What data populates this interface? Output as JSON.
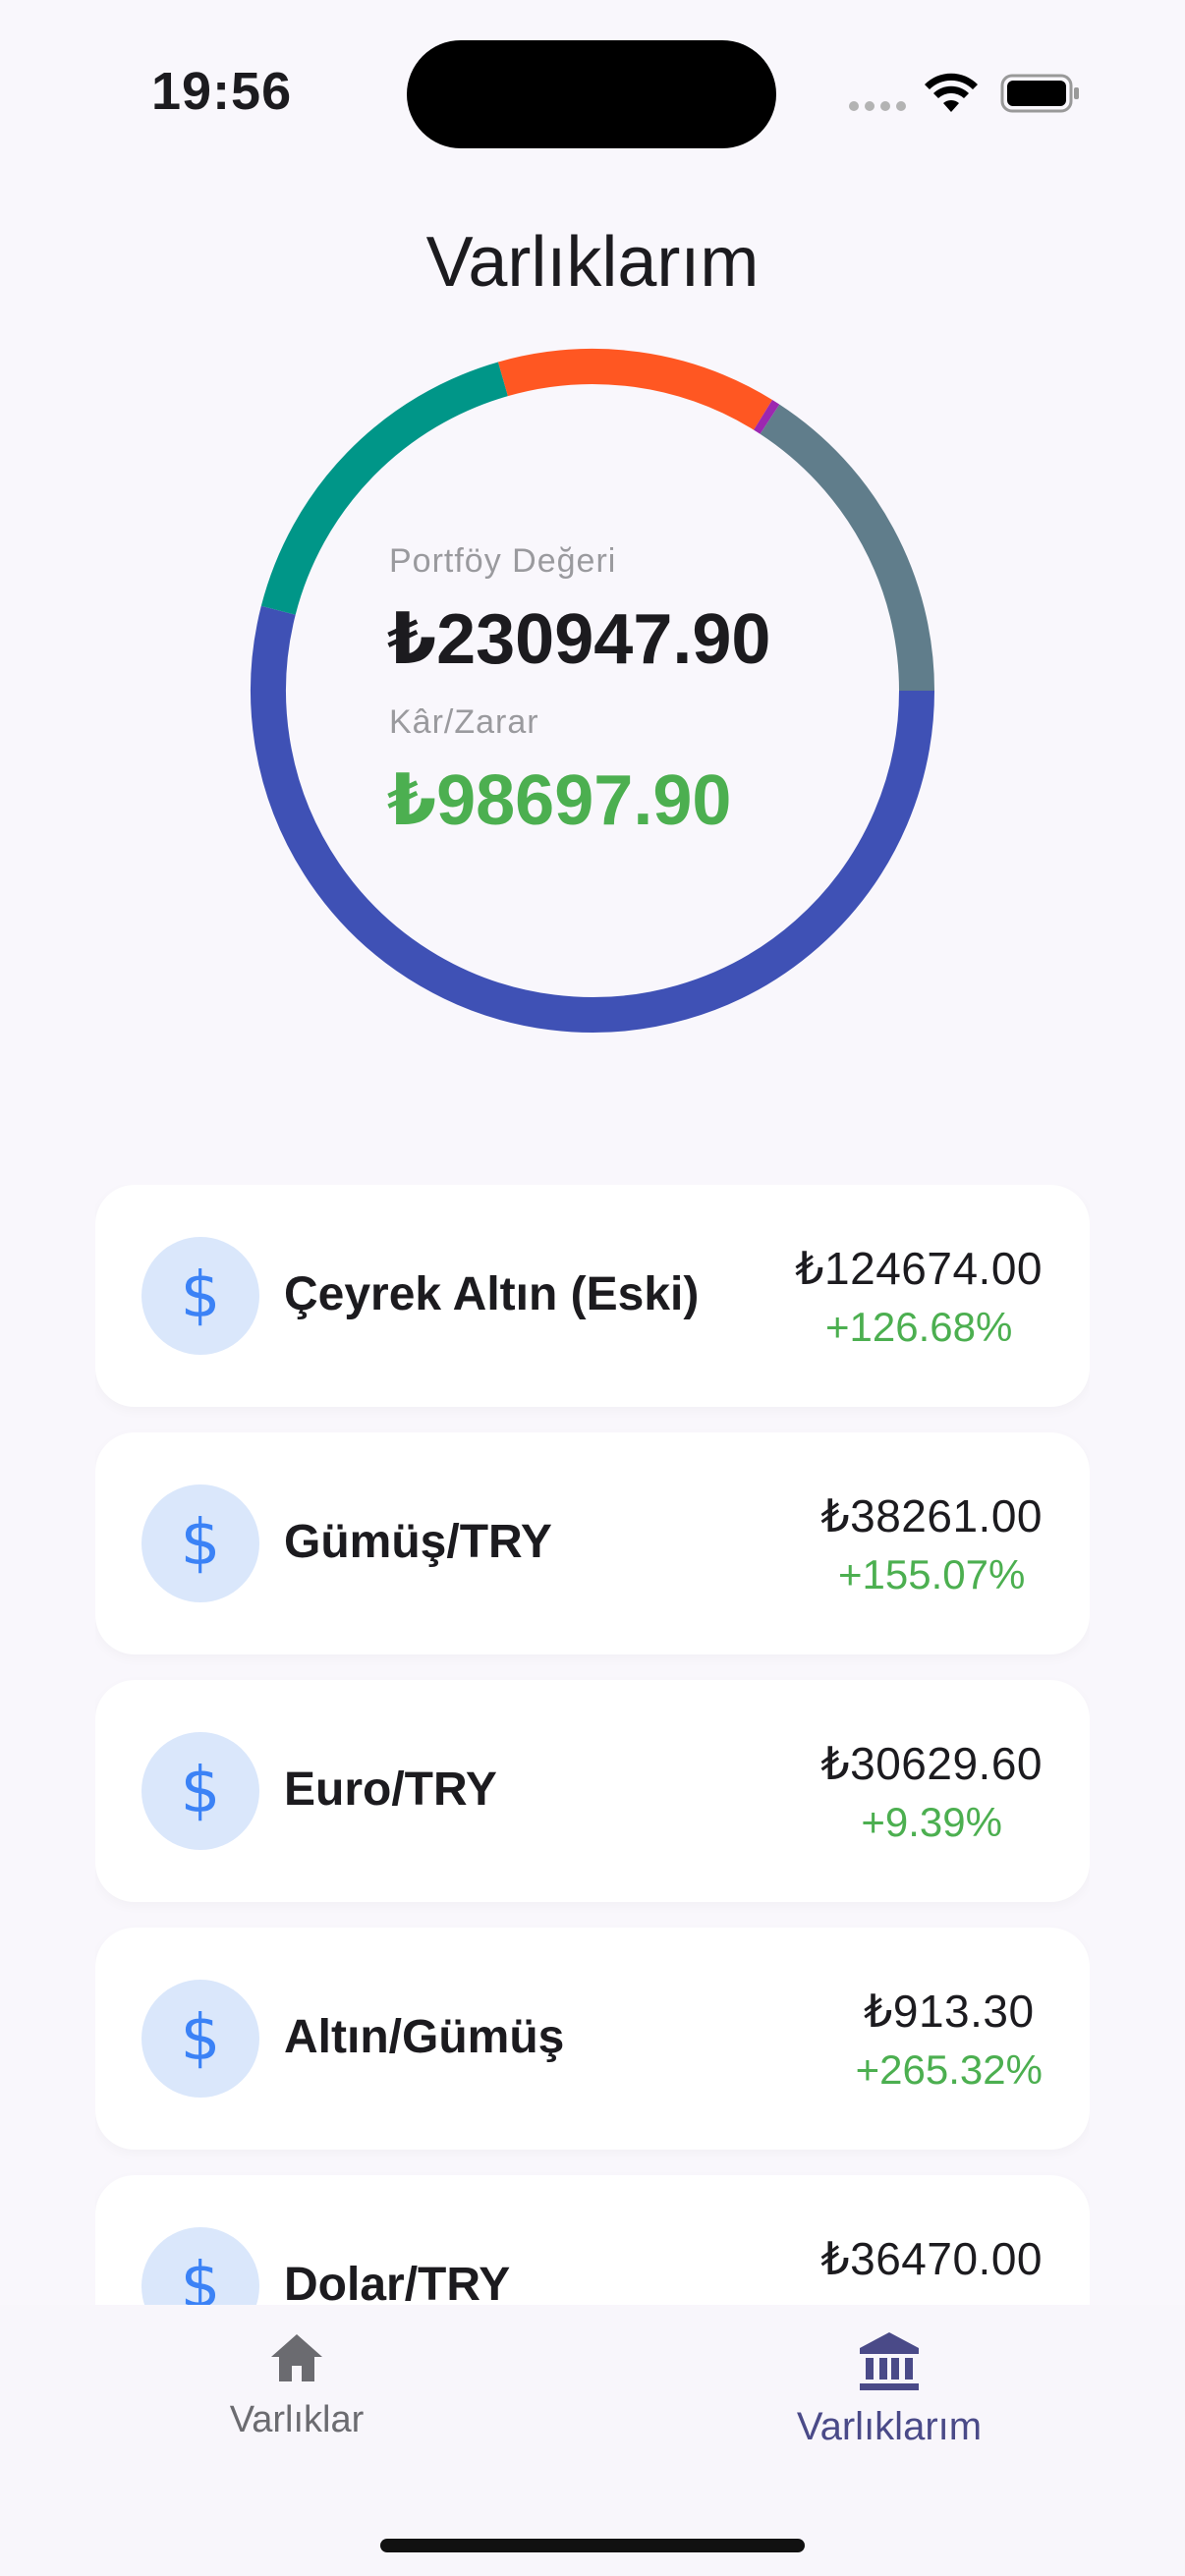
{
  "status_bar": {
    "time": "19:56"
  },
  "page": {
    "title": "Varlıklarım"
  },
  "portfolio": {
    "value_label": "Portföy Değeri",
    "value": "₺230947.90",
    "pl_label": "Kâr/Zarar",
    "pl_value": "₺98697.90",
    "pl_color": "#4caf50",
    "chart_data": {
      "type": "pie",
      "style": "donut",
      "categories": [
        "Çeyrek Altın (Eski)",
        "Gümüş/TRY",
        "Euro/TRY",
        "Altın/Gümüş",
        "Dolar/TRY"
      ],
      "values": [
        124674.0,
        38261.0,
        30629.6,
        913.3,
        36470.0
      ],
      "colors": [
        "#3f51b5",
        "#009688",
        "#ff5722",
        "#9c27b0",
        "#607d8b"
      ]
    }
  },
  "assets": [
    {
      "name": "Çeyrek Altın (Eski)",
      "value": "₺124674.00",
      "change": "+126.68%",
      "icon": "dollar-icon"
    },
    {
      "name": "Gümüş/TRY",
      "value": "₺38261.00",
      "change": "+155.07%",
      "icon": "dollar-icon"
    },
    {
      "name": "Euro/TRY",
      "value": "₺30629.60",
      "change": "+9.39%",
      "icon": "dollar-icon"
    },
    {
      "name": "Altın/Gümüş",
      "value": "₺913.30",
      "change": "+265.32%",
      "icon": "dollar-icon"
    },
    {
      "name": "Dolar/TRY",
      "value": "₺36470.00",
      "change": "",
      "icon": "dollar-icon"
    }
  ],
  "bottom_nav": {
    "items": [
      {
        "label": "Varlıklar",
        "icon": "home-icon",
        "active": false
      },
      {
        "label": "Varlıklarım",
        "icon": "bank-icon",
        "active": true
      }
    ]
  },
  "colors": {
    "background": "#f9f7fc",
    "icon_bg": "#dae7fb",
    "icon_fg": "#3b82f6",
    "nav_active": "#4a4a88"
  }
}
